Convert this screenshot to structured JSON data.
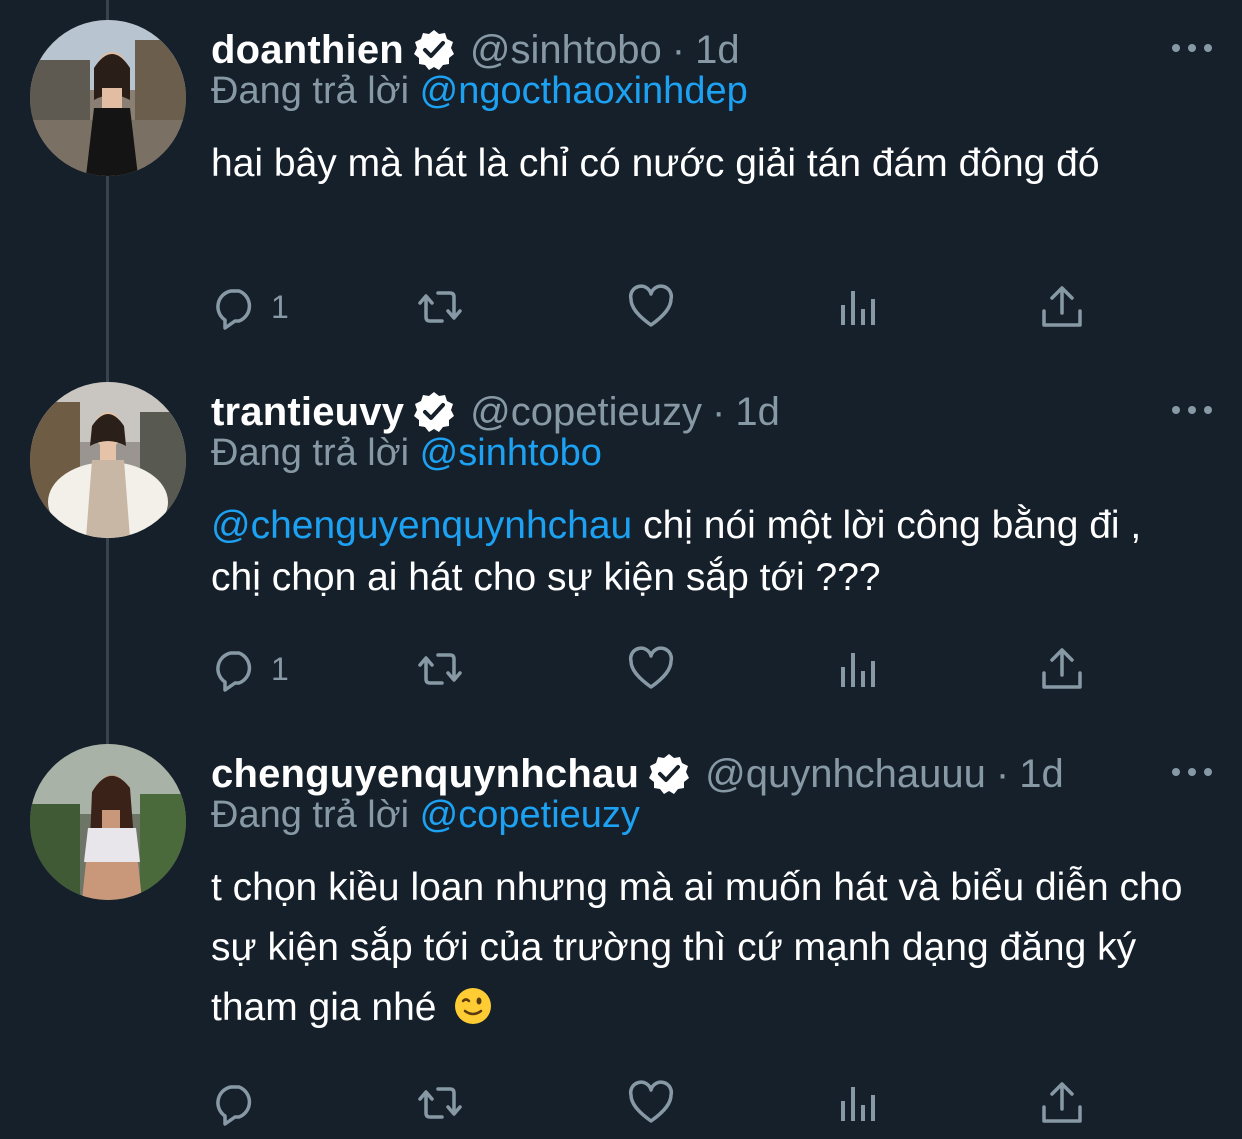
{
  "colors": {
    "background": "#15202b",
    "secondary_text": "#8899a6",
    "accent": "#1da1f2",
    "thread_line": "#38444d"
  },
  "reply_prefix": "Đang trả lời",
  "tweets": [
    {
      "display_name": "doanthien",
      "verified": true,
      "handle": "@sinhtobo",
      "separator": "·",
      "time": "1d",
      "reply_to": "@ngocthaoxinhdep",
      "body_mention": "",
      "body_text": "hai bây mà hát là chỉ có nước giải tán đám đông đó",
      "reply_count": "1",
      "icons": [
        "reply-icon",
        "retweet-icon",
        "like-icon",
        "analytics-icon",
        "share-icon"
      ]
    },
    {
      "display_name": "trantieuvy",
      "verified": true,
      "handle": "@copetieuzy",
      "separator": "·",
      "time": "1d",
      "reply_to": "@sinhtobo",
      "body_mention": "@chenguyenquynhchau",
      "body_text": " chị nói một lời công bằng đi , chị chọn ai hát cho sự kiện sắp tới ???",
      "reply_count": "1",
      "icons": [
        "reply-icon",
        "retweet-icon",
        "like-icon",
        "analytics-icon",
        "share-icon"
      ]
    },
    {
      "display_name": "chenguyenquynhchau",
      "verified": true,
      "handle": "@quynhchauuu",
      "separator": "·",
      "time": "1d",
      "reply_to": "@copetieuzy",
      "body_mention": "",
      "body_text": "t chọn kiều loan nhưng mà ai muốn hát và biểu diễn cho sự kiện sắp tới của trường thì cứ mạnh dạng đăng ký tham gia nhé",
      "body_emoji": "winking-face-emoji",
      "reply_count": "",
      "icons": [
        "reply-icon",
        "retweet-icon",
        "like-icon",
        "analytics-icon",
        "share-icon"
      ]
    }
  ]
}
